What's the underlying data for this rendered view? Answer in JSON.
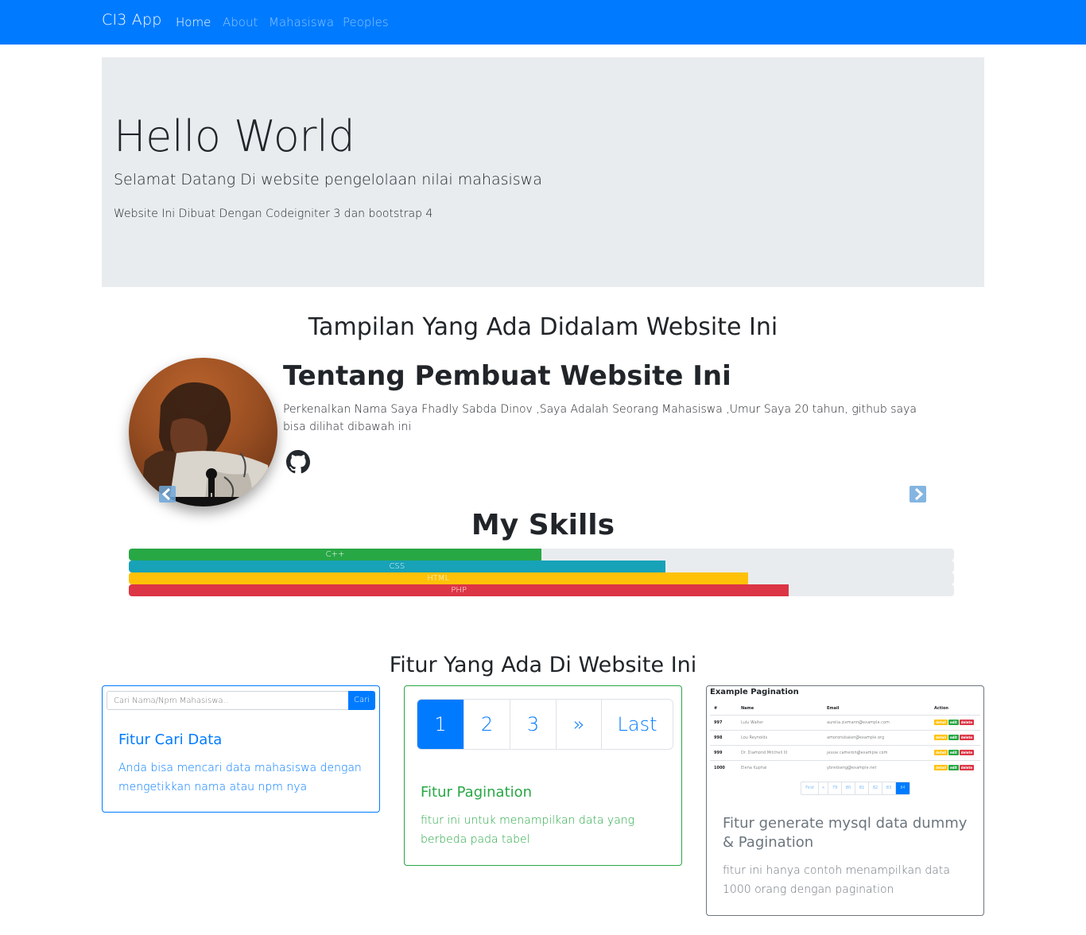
{
  "navbar": {
    "brand": "CI3 App",
    "links": [
      {
        "label": "Home",
        "active": true
      },
      {
        "label": "About",
        "active": false
      },
      {
        "label": "Mahasiswa",
        "active": false
      },
      {
        "label": "Peoples",
        "active": false
      }
    ]
  },
  "jumbotron": {
    "title": "Hello World",
    "lead": "Selamat Datang Di website pengelolaan nilai mahasiswa",
    "text": "Website Ini Dibuat Dengan Codeigniter 3 dan bootstrap 4"
  },
  "showcase": {
    "heading": "Tampilan Yang Ada Didalam Website Ini"
  },
  "about": {
    "title": "Tentang Pembuat Website Ini",
    "description": "Perkenalkan Nama Saya Fhadly Sabda Dinov ,Saya Adalah Seorang Mahasiswa ,Umur Saya 20 tahun, github saya bisa dilihat dibawah ini",
    "icon": "github-icon"
  },
  "skills": {
    "heading": "My Skills",
    "items": [
      {
        "label": "C++",
        "percent": 50,
        "color": "#28a745"
      },
      {
        "label": "CSS",
        "percent": 65,
        "color": "#17a2b8"
      },
      {
        "label": "HTML",
        "percent": 75,
        "color": "#ffc107"
      },
      {
        "label": "PHP",
        "percent": 80,
        "color": "#dc3545"
      }
    ]
  },
  "features": {
    "heading": "Fitur Yang Ada Di Website Ini",
    "search": {
      "placeholder": "Cari Nama/Npm Mahasiswa..",
      "button": "Cari",
      "title": "Fitur Cari Data",
      "text": "Anda bisa mencari data mahasiswa dengan mengetikkan nama atau npm nya"
    },
    "pagination": {
      "pages": [
        "1",
        "2",
        "3",
        "»",
        "Last"
      ],
      "title": "Fitur Pagination",
      "text": "fitur ini untuk menampilkan data yang berbeda pada tabel"
    },
    "generate": {
      "preview_title": "Example Pagination",
      "columns": [
        "#",
        "Name",
        "Email",
        "Action"
      ],
      "rows": [
        {
          "num": "997",
          "name": "Lulu Walter",
          "email": "aurelia.ziemann@example.com"
        },
        {
          "num": "998",
          "name": "Lou Reynolds",
          "email": "amoronsbaker@example.org"
        },
        {
          "num": "999",
          "name": "Dr. Diamond Mitchell III",
          "email": "jessie.cameron@example.com"
        },
        {
          "num": "1000",
          "name": "Elena Kuphal",
          "email": "ybrekkeng@example.net"
        }
      ],
      "actions": [
        {
          "label": "detail",
          "color": "#ffc107"
        },
        {
          "label": "edit",
          "color": "#28a745"
        },
        {
          "label": "delete",
          "color": "#dc3545"
        }
      ],
      "pager": [
        "First",
        "«",
        "79",
        "80",
        "81",
        "82",
        "83",
        "84"
      ],
      "title": "Fitur generate mysql data dummy & Pagination",
      "text": "fitur ini hanya contoh menampilkan data 1000 orang dengan pagination"
    }
  }
}
